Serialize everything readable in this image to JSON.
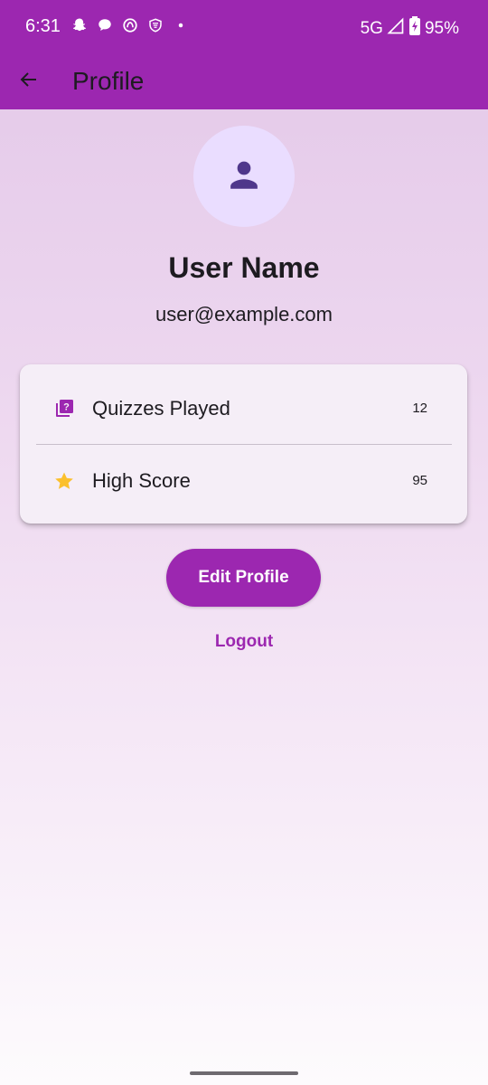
{
  "status_bar": {
    "time": "6:31",
    "network": "5G",
    "battery": "95%",
    "icons_left": [
      "snapchat-icon",
      "chat-bubble-icon",
      "app-icon",
      "vpn-icon",
      "dot-icon"
    ],
    "icons_right": [
      "signal-icon",
      "battery-icon"
    ],
    "color": "#9c27b0"
  },
  "app_bar": {
    "title": "Profile",
    "back_icon": "arrow-back-icon"
  },
  "profile": {
    "avatar_icon": "person-icon",
    "name": "User Name",
    "email": "user@example.com"
  },
  "stats": [
    {
      "icon": "quiz-icon",
      "label": "Quizzes Played",
      "value": "12"
    },
    {
      "icon": "star-icon",
      "label": "High Score",
      "value": "95"
    }
  ],
  "actions": {
    "edit_label": "Edit Profile",
    "logout_label": "Logout"
  },
  "colors": {
    "primary": "#9c27b0",
    "avatar_bg": "#eaddff",
    "avatar_icon": "#4f378b",
    "star": "#fbc02d",
    "card_bg": "#f5eef7"
  }
}
